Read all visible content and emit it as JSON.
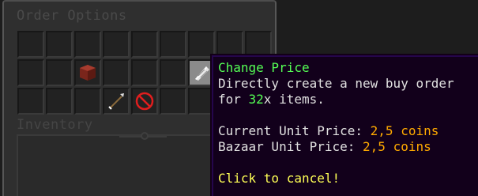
{
  "window": {
    "title": "Order Options",
    "inventory_label": "Inventory"
  },
  "grid": {
    "columns": 9,
    "rows": 3,
    "items": [
      {
        "row": 1,
        "col": 2,
        "icon": "red-block-icon",
        "color": "#8b2e22"
      },
      {
        "row": 1,
        "col": 6,
        "icon": "paper-icon",
        "color": "#d8d8d8"
      },
      {
        "row": 2,
        "col": 3,
        "icon": "arrow-icon",
        "color": "#c8c8c8"
      },
      {
        "row": 2,
        "col": 4,
        "icon": "barrier-icon",
        "color": "#e02020"
      }
    ]
  },
  "tooltip": {
    "title": "Change Price",
    "desc_line1": "Directly create a new buy order",
    "desc_line2_prefix": "for ",
    "desc_line2_amount": "32",
    "desc_line2_suffix": "x items.",
    "current_label": "Current Unit Price: ",
    "current_value": "2,5 coins",
    "bazaar_label": "Bazaar Unit Price: ",
    "bazaar_value": "2,5 coins",
    "action": "Click to cancel!"
  },
  "colors": {
    "title": "#55ff55",
    "gold": "#ffaa00",
    "yellow": "#ffff55",
    "text": "#e0e0e0",
    "tooltip_bg": "#12001b",
    "tooltip_border": "#25064c"
  }
}
